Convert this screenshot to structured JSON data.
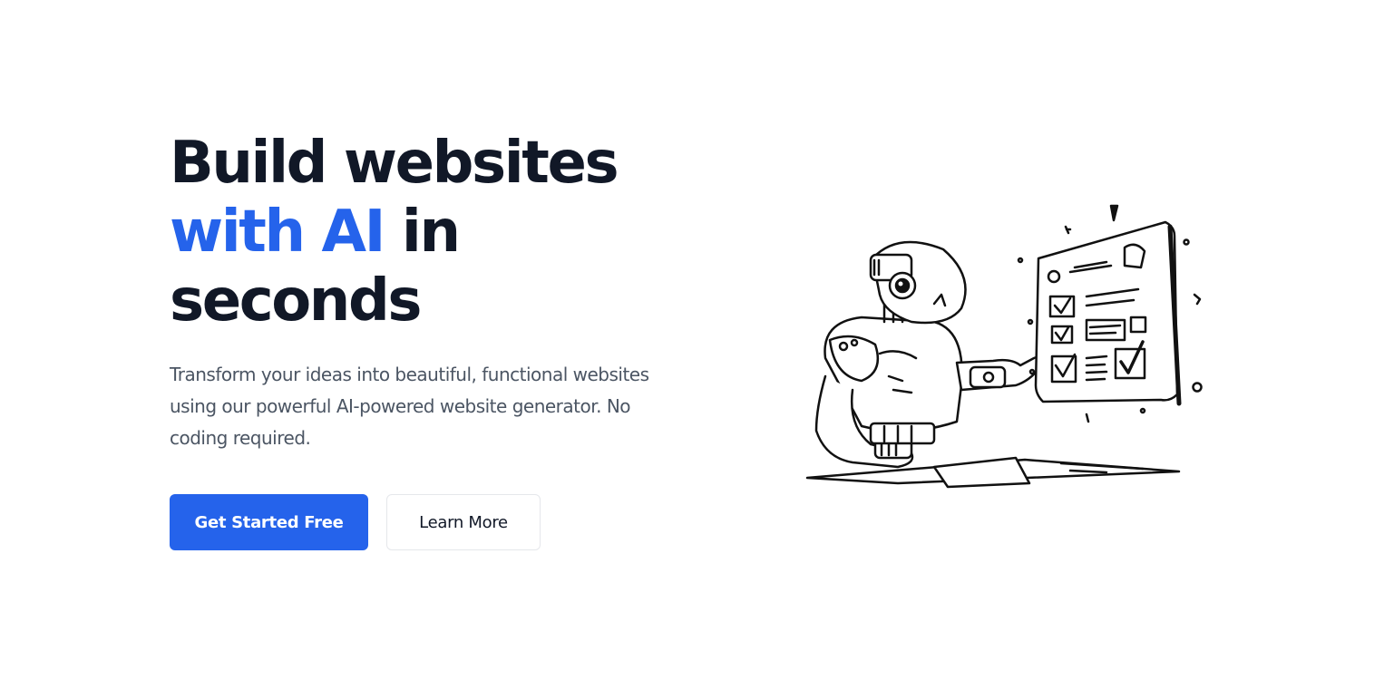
{
  "hero": {
    "headline_line1": "Build websites",
    "headline_accent": "with AI",
    "headline_line2_rest": " in",
    "headline_line3": "seconds",
    "subtitle": "Transform your ideas into beautiful, functional websites using our powerful AI-powered website generator. No coding required.",
    "accent_color": "#2563eb"
  },
  "buttons": {
    "primary_label": "Get Started Free",
    "secondary_label": "Learn More"
  },
  "illustration": {
    "subject": "robot-pointing-at-checklist"
  }
}
